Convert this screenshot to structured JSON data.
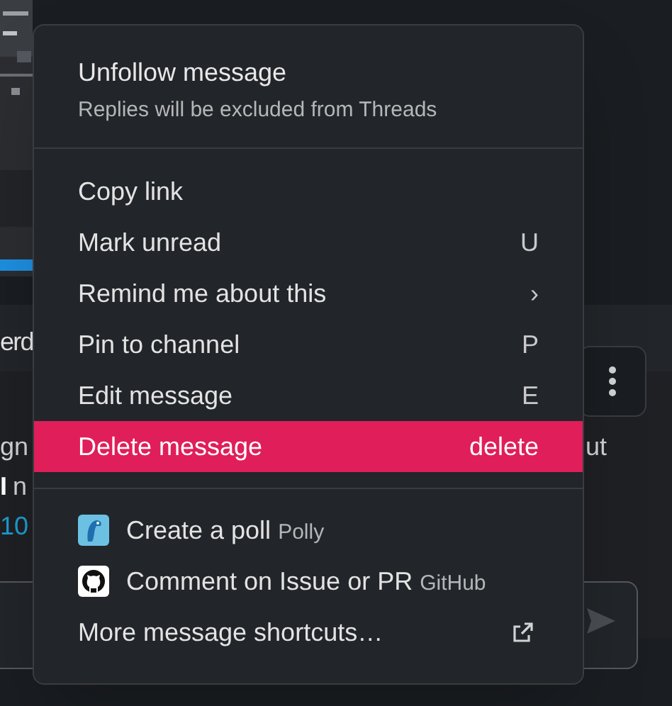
{
  "background": {
    "fragments": [
      {
        "text": "erd",
        "kind": "plain"
      },
      {
        "text": "gn",
        "kind": "plain"
      },
      {
        "text": "I",
        "kind": "bold"
      },
      {
        "text": "n",
        "kind": "plain"
      },
      {
        "text": "10",
        "kind": "link"
      },
      {
        "text": "ut",
        "kind": "plain"
      }
    ]
  },
  "menu": {
    "header": {
      "title": "Unfollow message",
      "subtitle": "Replies will be excluded from Threads"
    },
    "sections": [
      {
        "items": [
          {
            "label": "Copy link",
            "kind": "plain",
            "selected": false
          },
          {
            "label": "Mark unread",
            "shortcut": "U",
            "kind": "plain",
            "selected": false
          },
          {
            "label": "Remind me about this",
            "shortcut": "›",
            "kind": "plain",
            "selected": false
          },
          {
            "label": "Pin to channel",
            "shortcut": "P",
            "kind": "plain",
            "selected": false
          },
          {
            "label": "Edit message",
            "shortcut": "E",
            "kind": "plain",
            "selected": false
          },
          {
            "label": "Delete message",
            "shortcut": "delete",
            "kind": "plain",
            "selected": true
          }
        ]
      },
      {
        "items": [
          {
            "label": "Create a poll",
            "app": "Polly",
            "kind": "app",
            "selected": false
          },
          {
            "label": "Comment on Issue or PR",
            "app": "GitHub",
            "kind": "app",
            "selected": false
          },
          {
            "label": "More message shortcuts…",
            "kind": "external",
            "selected": false
          }
        ]
      }
    ]
  }
}
